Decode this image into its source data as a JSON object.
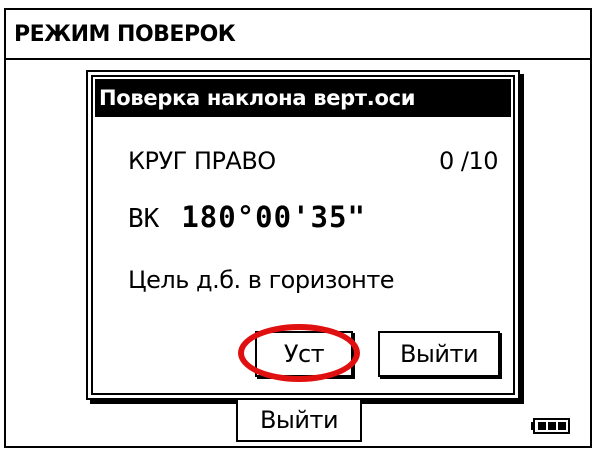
{
  "window": {
    "title": "РЕЖИМ ПОВЕРОК"
  },
  "dialog": {
    "title": "Поверка наклона верт.оси",
    "face_label": "КРУГ ПРАВО",
    "counter": "0 /10",
    "vk_label": "ВК",
    "vk_value": "180°00'35\"",
    "hint": "Цель д.б. в горизонте",
    "set_button": "Уст",
    "exit_button": "Выйти"
  },
  "footer": {
    "exit_button": "Выйти",
    "battery_icon": "battery-full-icon"
  },
  "colors": {
    "highlight": "#e01010",
    "title_bg": "#000000",
    "background": "#ffffff"
  }
}
